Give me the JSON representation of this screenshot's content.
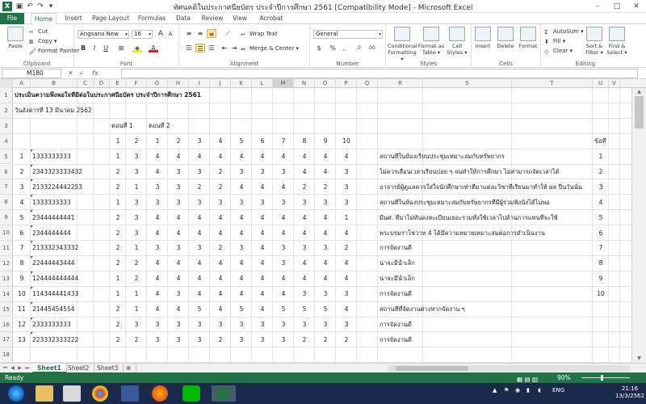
{
  "window": {
    "title": "ทัศนคติในประกาศนียบัตร ประจำปีการศึกษา 2561  [Compatibility Mode]  -  Microsoft Excel",
    "min": "–",
    "max": "□",
    "close": "✕"
  },
  "tabs": [
    {
      "label": "File"
    },
    {
      "label": "Home"
    },
    {
      "label": "Insert"
    },
    {
      "label": "Page Layout"
    },
    {
      "label": "Formulas"
    },
    {
      "label": "Data"
    },
    {
      "label": "Review"
    },
    {
      "label": "View"
    },
    {
      "label": "Acrobat"
    }
  ],
  "ribbon": {
    "clipboard": {
      "label": "Clipboard",
      "paste": "Paste",
      "cut": "Cut",
      "copy": "Copy ▾",
      "format_painter": "Format Painter"
    },
    "font": {
      "label": "Font",
      "font_name": "Angsana New",
      "font_size": "16",
      "bold": "B",
      "italic": "I",
      "underline": "U",
      "grow": "A",
      "shrink": "A"
    },
    "alignment": {
      "label": "Alignment",
      "wrap": "Wrap Text",
      "merge": "Merge & Center ▾"
    },
    "number": {
      "label": "Number",
      "format": "General",
      "currency": "$",
      "percent": "%",
      "comma": ","
    },
    "styles": {
      "label": "Styles",
      "conditional": "Conditional Formatting ▾",
      "format_table": "Format as Table ▾",
      "cell_styles": "Cell Styles ▾"
    },
    "cells": {
      "label": "Cells",
      "insert": "Insert",
      "delete": "Delete",
      "format": "Format"
    },
    "editing": {
      "label": "Editing",
      "autosum": "AutoSum ▾",
      "fill": "Fill ▾",
      "clear": "Clear ▾",
      "sort": "Sort & Filter ▾",
      "find": "Find & Select ▾"
    }
  },
  "formula_bar": {
    "name_box": "M180",
    "fx": "fx",
    "value": ""
  },
  "columns": [
    {
      "label": "A"
    },
    {
      "label": "B"
    },
    {
      "label": "C"
    },
    {
      "label": "D"
    },
    {
      "label": "E"
    },
    {
      "label": "F"
    },
    {
      "label": "G"
    },
    {
      "label": "H"
    },
    {
      "label": "I"
    },
    {
      "label": "J"
    },
    {
      "label": "K"
    },
    {
      "label": "L"
    },
    {
      "label": "M"
    },
    {
      "label": "N"
    },
    {
      "label": "O"
    },
    {
      "label": "P"
    },
    {
      "label": "Q"
    },
    {
      "label": "R"
    },
    {
      "label": "S"
    },
    {
      "label": "T"
    },
    {
      "label": "U"
    },
    {
      "label": "V"
    }
  ],
  "rows": [
    "1",
    "2",
    "3",
    "4",
    "5",
    "6",
    "7",
    "8",
    "9",
    "10",
    "11",
    "12",
    "13",
    "14",
    "15",
    "16",
    "17",
    "18"
  ],
  "sheet": {
    "title": "ประเมินความพึงพอใจที่มีต่อในประกาศนียบัตร ประจำปีการศึกษา 2561",
    "date": "วันอังคารที่ 13 มีนาคม 2562",
    "part1": "ตอนที่ 1",
    "part2": "ตอนที่ 2",
    "header_nums": [
      "1",
      "2",
      "1",
      "2",
      "3",
      "4",
      "5",
      "6",
      "7",
      "8",
      "9",
      "10"
    ],
    "col_u_header": "ข้อที่",
    "col_v_header": "ข",
    "data": [
      {
        "no": "1",
        "code": "1333333333",
        "vals": [
          "1",
          "3",
          "4",
          "4",
          "4",
          "4",
          "4",
          "4",
          "4",
          "4",
          "4",
          "4"
        ],
        "comment": "สถานที่ในห้องเรียนประชุมเหมาะสมกับทรัพยากร",
        "u": "1"
      },
      {
        "no": "2",
        "code": "2343323333432",
        "vals": [
          "2",
          "3",
          "4",
          "3",
          "3",
          "2",
          "3",
          "3",
          "3",
          "4",
          "4",
          "3"
        ],
        "comment": "ไม่ควรเลื่อนเวลาเรียนบ่อย ๆ จนทำให้การศึกษา ไม่สามารถจัดเวลาได้",
        "u": "2"
      },
      {
        "no": "3",
        "code": "2133224442253",
        "vals": [
          "2",
          "1",
          "3",
          "3",
          "2",
          "2",
          "4",
          "4",
          "4",
          "2",
          "2",
          "3"
        ],
        "comment": "อาจารย์ผู้ดูแลควรใส่ใจนักศึกษาเท่าที่มาแต่ละวิชาที่เรียนมาทำให้ ผล ปีนวันนั้น",
        "u": "3"
      },
      {
        "no": "4",
        "code": "1333333333",
        "vals": [
          "1",
          "3",
          "3",
          "3",
          "3",
          "3",
          "3",
          "3",
          "3",
          "3",
          "3",
          "3"
        ],
        "comment": "สถานที่ในห้องประชุมเหมาะสมกับทรัพยากรที่มีผู้ร่วมฟังนั่งได้ไม่พอ",
        "u": "4"
      },
      {
        "no": "5",
        "code": "23444444441",
        "vals": [
          "2",
          "3",
          "4",
          "4",
          "4",
          "4",
          "4",
          "4",
          "4",
          "4",
          "4",
          "1"
        ],
        "comment": "มีนศ. ที่มาไม่ทันลงทะเบียนเยอะรวมทั้งใช้เวลาไปด้านการแทนที่จะใช้",
        "u": "5"
      },
      {
        "no": "6",
        "code": "2344444444",
        "vals": [
          "2",
          "3",
          "4",
          "4",
          "4",
          "4",
          "4",
          "4",
          "4",
          "4",
          "4",
          "4"
        ],
        "comment": "พระบรมราโชวาท 4 ได้มีความหมายเหมาะสมต่อการดำเนินงาน",
        "u": "6"
      },
      {
        "no": "7",
        "code": "213332343332",
        "vals": [
          "2",
          "1",
          "3",
          "3",
          "3",
          "2",
          "3",
          "4",
          "3",
          "3",
          "3",
          "2"
        ],
        "comment": "การจัดงานดี",
        "u": "7"
      },
      {
        "no": "8",
        "code": "22444443444",
        "vals": [
          "2",
          "2",
          "4",
          "4",
          "4",
          "4",
          "4",
          "4",
          "3",
          "4",
          "4",
          "4"
        ],
        "comment": "น่าจะมีน้ำเล็ก",
        "u": "8"
      },
      {
        "no": "9",
        "code": "124444444444",
        "vals": [
          "1",
          "2",
          "4",
          "4",
          "4",
          "4",
          "4",
          "4",
          "4",
          "4",
          "4",
          "4"
        ],
        "comment": "น่าจะมีน้ำเล็ก",
        "u": "9"
      },
      {
        "no": "10",
        "code": "114344441433",
        "vals": [
          "1",
          "1",
          "4",
          "3",
          "4",
          "4",
          "4",
          "4",
          "4",
          "3",
          "3",
          "3"
        ],
        "comment": "การจัดงานดี",
        "u": "10"
      },
      {
        "no": "11",
        "code": "21445454554",
        "vals": [
          "2",
          "1",
          "4",
          "4",
          "5",
          "4",
          "5",
          "4",
          "5",
          "5",
          "5",
          "4"
        ],
        "comment": "สถานที่ที่จัดงานต่างหากจัดงาน ๆ",
        "u": ""
      },
      {
        "no": "12",
        "code": "2333333333",
        "vals": [
          "2",
          "3",
          "3",
          "3",
          "3",
          "3",
          "3",
          "3",
          "3",
          "3",
          "3",
          "3"
        ],
        "comment": "การจัดงานดี",
        "u": ""
      },
      {
        "no": "13",
        "code": "223332333222",
        "vals": [
          "2",
          "2",
          "3",
          "3",
          "3",
          "2",
          "3",
          "3",
          "3",
          "2",
          "2",
          "2"
        ],
        "comment": "การจัดงานดี",
        "u": ""
      }
    ]
  },
  "sheet_tabs": [
    {
      "label": "Sheet1"
    },
    {
      "label": "Sheet2"
    },
    {
      "label": "Sheet3"
    }
  ],
  "status": {
    "ready": "Ready",
    "zoom": "90%"
  },
  "taskbar": {
    "lang": "ENG",
    "time": "21:16",
    "date": "13/3/2562"
  },
  "colors": {
    "excel_green": "#217346",
    "taskbar": "#1b2a4a"
  }
}
